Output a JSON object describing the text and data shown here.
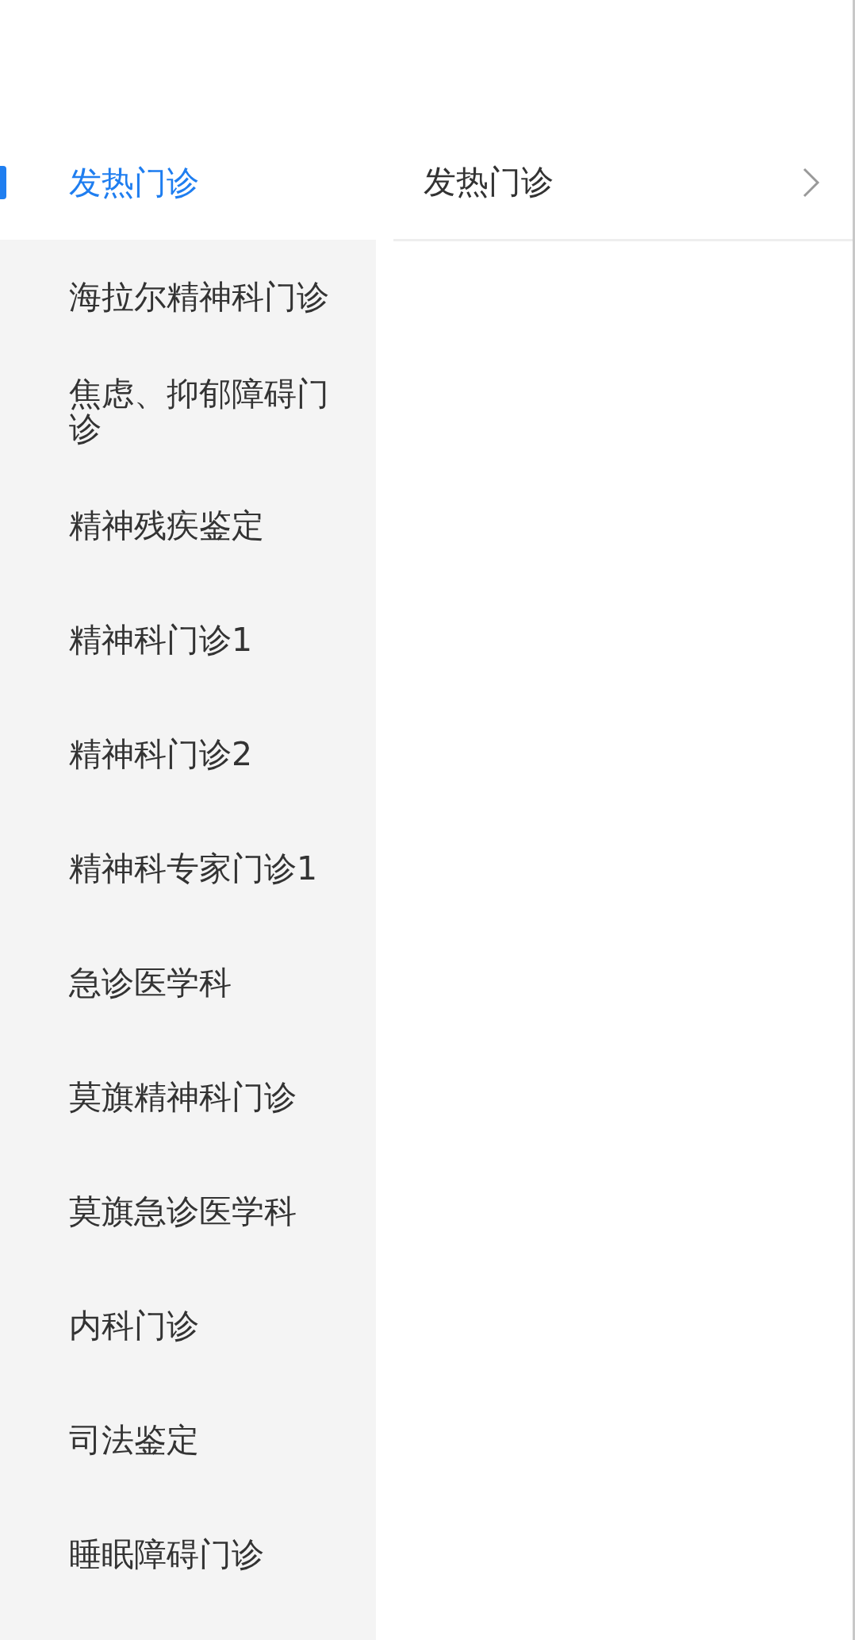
{
  "sidebar": {
    "items": [
      {
        "label": "发热门诊",
        "selected": true
      },
      {
        "label": "海拉尔精神科门诊",
        "selected": false
      },
      {
        "label": "焦虑、抑郁障碍门诊",
        "selected": false
      },
      {
        "label": "精神残疾鉴定",
        "selected": false
      },
      {
        "label": "精神科门诊1",
        "selected": false
      },
      {
        "label": "精神科门诊2",
        "selected": false
      },
      {
        "label": "精神科专家门诊1",
        "selected": false
      },
      {
        "label": "急诊医学科",
        "selected": false
      },
      {
        "label": "莫旗精神科门诊",
        "selected": false
      },
      {
        "label": "莫旗急诊医学科",
        "selected": false
      },
      {
        "label": "内科门诊",
        "selected": false
      },
      {
        "label": "司法鉴定",
        "selected": false
      },
      {
        "label": "睡眠障碍门诊",
        "selected": false
      }
    ]
  },
  "content": {
    "rows": [
      {
        "label": "发热门诊"
      }
    ]
  }
}
